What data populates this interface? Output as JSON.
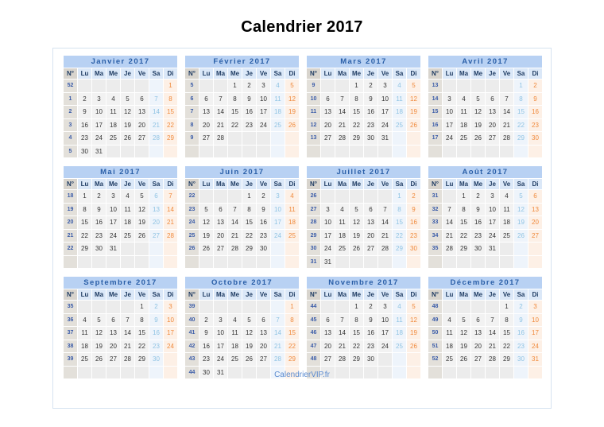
{
  "title": "Calendrier 2017",
  "year": "2017",
  "footer": {
    "label": "CalendrierVIP.fr"
  },
  "colors": {
    "month_header_bg": "#b8d1f3",
    "month_header_text": "#2a5fa8",
    "dow_bg": "#dbe8f8",
    "weeknum_bg": "#e3e0da",
    "weeknum_text": "#3b5ca8",
    "weekday_bg": "#f2f2f2",
    "saturday_text": "#8fc3e3",
    "sunday_text": "#f08a3c",
    "frame_border": "#d6e3f0",
    "footer_text": "#5b8bd0"
  },
  "day_headers": [
    "N°",
    "Lu",
    "Ma",
    "Me",
    "Je",
    "Ve",
    "Sa",
    "Di"
  ],
  "months": [
    {
      "name": "Janvier 2017",
      "weeks": [
        {
          "n": "52",
          "days": [
            "",
            "",
            "",
            "",
            "",
            "",
            "1"
          ]
        },
        {
          "n": "1",
          "days": [
            "2",
            "3",
            "4",
            "5",
            "6",
            "7",
            "8"
          ]
        },
        {
          "n": "2",
          "days": [
            "9",
            "10",
            "11",
            "12",
            "13",
            "14",
            "15"
          ]
        },
        {
          "n": "3",
          "days": [
            "16",
            "17",
            "18",
            "19",
            "20",
            "21",
            "22"
          ]
        },
        {
          "n": "4",
          "days": [
            "23",
            "24",
            "25",
            "26",
            "27",
            "28",
            "29"
          ]
        },
        {
          "n": "5",
          "days": [
            "30",
            "31",
            "",
            "",
            "",
            "",
            ""
          ]
        }
      ]
    },
    {
      "name": "Février 2017",
      "weeks": [
        {
          "n": "5",
          "days": [
            "",
            "",
            "1",
            "2",
            "3",
            "4",
            "5"
          ]
        },
        {
          "n": "6",
          "days": [
            "6",
            "7",
            "8",
            "9",
            "10",
            "11",
            "12"
          ]
        },
        {
          "n": "7",
          "days": [
            "13",
            "14",
            "15",
            "16",
            "17",
            "18",
            "19"
          ]
        },
        {
          "n": "8",
          "days": [
            "20",
            "21",
            "22",
            "23",
            "24",
            "25",
            "26"
          ]
        },
        {
          "n": "9",
          "days": [
            "27",
            "28",
            "",
            "",
            "",
            "",
            ""
          ]
        },
        {
          "n": "",
          "days": [
            "",
            "",
            "",
            "",
            "",
            "",
            ""
          ]
        }
      ]
    },
    {
      "name": "Mars 2017",
      "weeks": [
        {
          "n": "9",
          "days": [
            "",
            "",
            "1",
            "2",
            "3",
            "4",
            "5"
          ]
        },
        {
          "n": "10",
          "days": [
            "6",
            "7",
            "8",
            "9",
            "10",
            "11",
            "12"
          ]
        },
        {
          "n": "11",
          "days": [
            "13",
            "14",
            "15",
            "16",
            "17",
            "18",
            "19"
          ]
        },
        {
          "n": "12",
          "days": [
            "20",
            "21",
            "22",
            "23",
            "24",
            "25",
            "26"
          ]
        },
        {
          "n": "13",
          "days": [
            "27",
            "28",
            "29",
            "30",
            "31",
            "",
            ""
          ]
        },
        {
          "n": "",
          "days": [
            "",
            "",
            "",
            "",
            "",
            "",
            ""
          ]
        }
      ]
    },
    {
      "name": "Avril 2017",
      "weeks": [
        {
          "n": "13",
          "days": [
            "",
            "",
            "",
            "",
            "",
            "1",
            "2"
          ]
        },
        {
          "n": "14",
          "days": [
            "3",
            "4",
            "5",
            "6",
            "7",
            "8",
            "9"
          ]
        },
        {
          "n": "15",
          "days": [
            "10",
            "11",
            "12",
            "13",
            "14",
            "15",
            "16"
          ]
        },
        {
          "n": "16",
          "days": [
            "17",
            "18",
            "19",
            "20",
            "21",
            "22",
            "23"
          ]
        },
        {
          "n": "17",
          "days": [
            "24",
            "25",
            "26",
            "27",
            "28",
            "29",
            "30"
          ]
        },
        {
          "n": "",
          "days": [
            "",
            "",
            "",
            "",
            "",
            "",
            ""
          ]
        }
      ]
    },
    {
      "name": "Mai 2017",
      "weeks": [
        {
          "n": "18",
          "days": [
            "1",
            "2",
            "3",
            "4",
            "5",
            "6",
            "7"
          ]
        },
        {
          "n": "19",
          "days": [
            "8",
            "9",
            "10",
            "11",
            "12",
            "13",
            "14"
          ]
        },
        {
          "n": "20",
          "days": [
            "15",
            "16",
            "17",
            "18",
            "19",
            "20",
            "21"
          ]
        },
        {
          "n": "21",
          "days": [
            "22",
            "23",
            "24",
            "25",
            "26",
            "27",
            "28"
          ]
        },
        {
          "n": "22",
          "days": [
            "29",
            "30",
            "31",
            "",
            "",
            "",
            ""
          ]
        },
        {
          "n": "",
          "days": [
            "",
            "",
            "",
            "",
            "",
            "",
            ""
          ]
        }
      ]
    },
    {
      "name": "Juin 2017",
      "weeks": [
        {
          "n": "22",
          "days": [
            "",
            "",
            "",
            "1",
            "2",
            "3",
            "4"
          ]
        },
        {
          "n": "23",
          "days": [
            "5",
            "6",
            "7",
            "8",
            "9",
            "10",
            "11"
          ]
        },
        {
          "n": "24",
          "days": [
            "12",
            "13",
            "14",
            "15",
            "16",
            "17",
            "18"
          ]
        },
        {
          "n": "25",
          "days": [
            "19",
            "20",
            "21",
            "22",
            "23",
            "24",
            "25"
          ]
        },
        {
          "n": "26",
          "days": [
            "26",
            "27",
            "28",
            "29",
            "30",
            "",
            ""
          ]
        },
        {
          "n": "",
          "days": [
            "",
            "",
            "",
            "",
            "",
            "",
            ""
          ]
        }
      ]
    },
    {
      "name": "Juillet 2017",
      "weeks": [
        {
          "n": "26",
          "days": [
            "",
            "",
            "",
            "",
            "",
            "1",
            "2"
          ]
        },
        {
          "n": "27",
          "days": [
            "3",
            "4",
            "5",
            "6",
            "7",
            "8",
            "9"
          ]
        },
        {
          "n": "28",
          "days": [
            "10",
            "11",
            "12",
            "13",
            "14",
            "15",
            "16"
          ]
        },
        {
          "n": "29",
          "days": [
            "17",
            "18",
            "19",
            "20",
            "21",
            "22",
            "23"
          ]
        },
        {
          "n": "30",
          "days": [
            "24",
            "25",
            "26",
            "27",
            "28",
            "29",
            "30"
          ]
        },
        {
          "n": "31",
          "days": [
            "31",
            "",
            "",
            "",
            "",
            "",
            ""
          ]
        }
      ]
    },
    {
      "name": "Août 2017",
      "weeks": [
        {
          "n": "31",
          "days": [
            "",
            "1",
            "2",
            "3",
            "4",
            "5",
            "6"
          ]
        },
        {
          "n": "32",
          "days": [
            "7",
            "8",
            "9",
            "10",
            "11",
            "12",
            "13"
          ]
        },
        {
          "n": "33",
          "days": [
            "14",
            "15",
            "16",
            "17",
            "18",
            "19",
            "20"
          ]
        },
        {
          "n": "34",
          "days": [
            "21",
            "22",
            "23",
            "24",
            "25",
            "26",
            "27"
          ]
        },
        {
          "n": "35",
          "days": [
            "28",
            "29",
            "30",
            "31",
            "",
            "",
            ""
          ]
        },
        {
          "n": "",
          "days": [
            "",
            "",
            "",
            "",
            "",
            "",
            ""
          ]
        }
      ]
    },
    {
      "name": "Septembre 2017",
      "weeks": [
        {
          "n": "35",
          "days": [
            "",
            "",
            "",
            "",
            "1",
            "2",
            "3"
          ]
        },
        {
          "n": "36",
          "days": [
            "4",
            "5",
            "6",
            "7",
            "8",
            "9",
            "10"
          ]
        },
        {
          "n": "37",
          "days": [
            "11",
            "12",
            "13",
            "14",
            "15",
            "16",
            "17"
          ]
        },
        {
          "n": "38",
          "days": [
            "18",
            "19",
            "20",
            "21",
            "22",
            "23",
            "24"
          ]
        },
        {
          "n": "39",
          "days": [
            "25",
            "26",
            "27",
            "28",
            "29",
            "30",
            ""
          ]
        },
        {
          "n": "",
          "days": [
            "",
            "",
            "",
            "",
            "",
            "",
            ""
          ]
        }
      ]
    },
    {
      "name": "Octobre 2017",
      "weeks": [
        {
          "n": "39",
          "days": [
            "",
            "",
            "",
            "",
            "",
            "",
            "1"
          ]
        },
        {
          "n": "40",
          "days": [
            "2",
            "3",
            "4",
            "5",
            "6",
            "7",
            "8"
          ]
        },
        {
          "n": "41",
          "days": [
            "9",
            "10",
            "11",
            "12",
            "13",
            "14",
            "15"
          ]
        },
        {
          "n": "42",
          "days": [
            "16",
            "17",
            "18",
            "19",
            "20",
            "21",
            "22"
          ]
        },
        {
          "n": "43",
          "days": [
            "23",
            "24",
            "25",
            "26",
            "27",
            "28",
            "29"
          ]
        },
        {
          "n": "44",
          "days": [
            "30",
            "31",
            "",
            "",
            "",
            "",
            ""
          ]
        }
      ]
    },
    {
      "name": "Novembre 2017",
      "weeks": [
        {
          "n": "44",
          "days": [
            "",
            "",
            "1",
            "2",
            "3",
            "4",
            "5"
          ]
        },
        {
          "n": "45",
          "days": [
            "6",
            "7",
            "8",
            "9",
            "10",
            "11",
            "12"
          ]
        },
        {
          "n": "46",
          "days": [
            "13",
            "14",
            "15",
            "16",
            "17",
            "18",
            "19"
          ]
        },
        {
          "n": "47",
          "days": [
            "20",
            "21",
            "22",
            "23",
            "24",
            "25",
            "26"
          ]
        },
        {
          "n": "48",
          "days": [
            "27",
            "28",
            "29",
            "30",
            "",
            "",
            ""
          ]
        },
        {
          "n": "",
          "days": [
            "",
            "",
            "",
            "",
            "",
            "",
            ""
          ]
        }
      ]
    },
    {
      "name": "Décembre 2017",
      "weeks": [
        {
          "n": "48",
          "days": [
            "",
            "",
            "",
            "",
            "1",
            "2",
            "3"
          ]
        },
        {
          "n": "49",
          "days": [
            "4",
            "5",
            "6",
            "7",
            "8",
            "9",
            "10"
          ]
        },
        {
          "n": "50",
          "days": [
            "11",
            "12",
            "13",
            "14",
            "15",
            "16",
            "17"
          ]
        },
        {
          "n": "51",
          "days": [
            "18",
            "19",
            "20",
            "21",
            "22",
            "23",
            "24"
          ]
        },
        {
          "n": "52",
          "days": [
            "25",
            "26",
            "27",
            "28",
            "29",
            "30",
            "31"
          ]
        },
        {
          "n": "",
          "days": [
            "",
            "",
            "",
            "",
            "",
            "",
            ""
          ]
        }
      ]
    }
  ]
}
